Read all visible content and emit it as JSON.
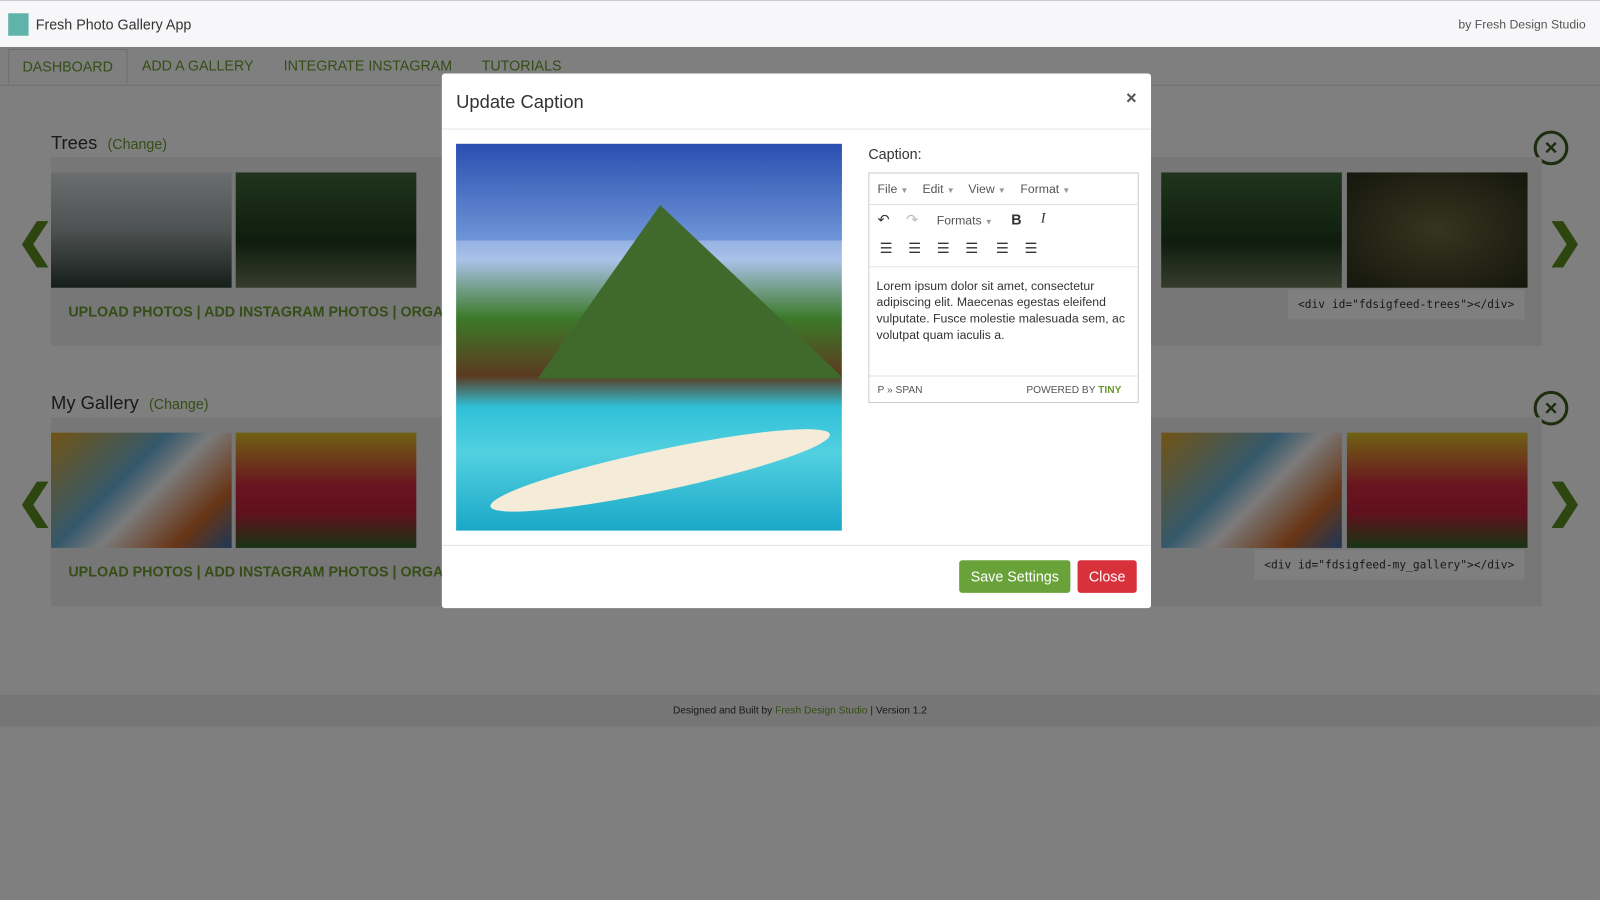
{
  "app": {
    "title": "Fresh Photo Gallery App",
    "byline": "by Fresh Design Studio"
  },
  "tabs": [
    "DASHBOARD",
    "ADD A GALLERY",
    "INTEGRATE INSTAGRAM",
    "TUTORIALS"
  ],
  "galleries": [
    {
      "name": "Trees",
      "change": "(Change)",
      "links": "UPLOAD PHOTOS | ADD INSTAGRAM PHOTOS | ORGA",
      "embed": "<div id=\"fdsigfeed-trees\"></div>"
    },
    {
      "name": "My Gallery",
      "change": "(Change)",
      "links": "UPLOAD PHOTOS | ADD INSTAGRAM PHOTOS | ORGA",
      "embed": "<div id=\"fdsigfeed-my_gallery\"></div>"
    }
  ],
  "footer": {
    "prefix": "Designed and Built by",
    "link": "Fresh Design Studio",
    "suffix": "| Version 1.2"
  },
  "modal": {
    "title": "Update Caption",
    "close_x": "×",
    "caption_label": "Caption:",
    "menu": [
      "File",
      "Edit",
      "View",
      "Format"
    ],
    "formats": "Formats",
    "bold": "B",
    "italic": "I",
    "body": "Lorem ipsum dolor sit amet, consectetur adipiscing elit. Maecenas egestas eleifend vulputate. Fusce molestie malesuada sem, ac volutpat quam iaculis a.",
    "path": "P » SPAN",
    "powered": "POWERED BY",
    "tiny": "TINY",
    "save": "Save Settings",
    "close": "Close"
  },
  "colors": {
    "accent": "#6a9a2d",
    "save": "#6aa23a",
    "close": "#d9313c"
  }
}
